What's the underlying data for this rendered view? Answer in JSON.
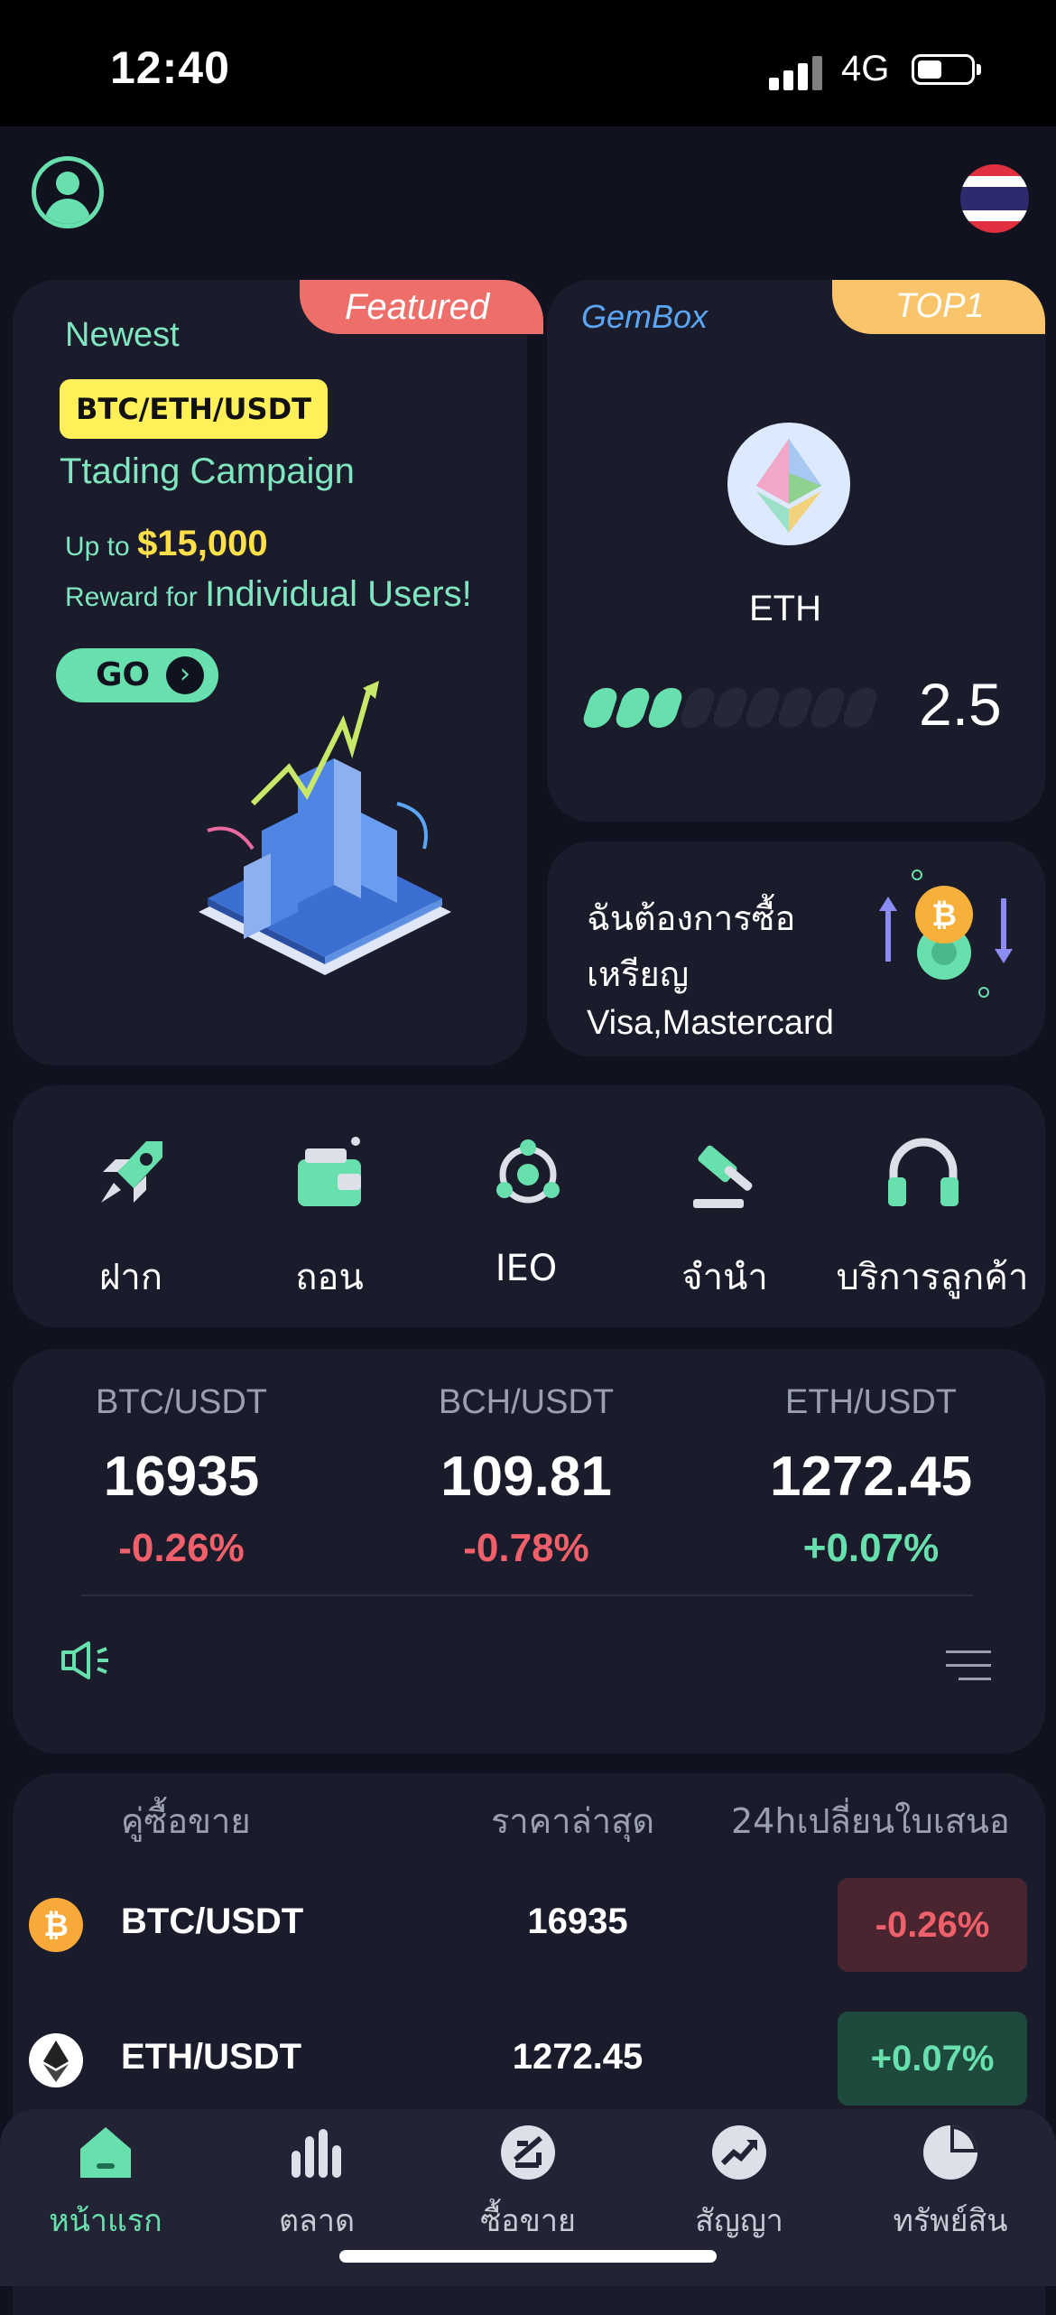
{
  "status_bar": {
    "time": "12:40",
    "network": "4G"
  },
  "featured": {
    "tag": "Featured",
    "newest": "Newest",
    "pairs": "BTC/ETH/USDT",
    "campaign": "Ttading Campaign",
    "upto_prefix": "Up to",
    "upto_amount": "$15,000",
    "reward_prefix": "Reward for",
    "reward_target": "Individual Users!",
    "go": "GO",
    "go_arrow": "›"
  },
  "gembox": {
    "title": "GemBox",
    "tag": "TOP1",
    "coin": "ETH",
    "score": "2.5",
    "progress_fraction": 0.3
  },
  "buy_coin": {
    "line1": "ฉันต้องการซื้อ",
    "line2": "เหรียญ",
    "line3": "Visa,Mastercard"
  },
  "quick_actions": [
    {
      "label": "ฝาก",
      "icon": "rocket-icon"
    },
    {
      "label": "ถอน",
      "icon": "wallet-icon"
    },
    {
      "label": "IEO",
      "icon": "ieo-orbit-icon"
    },
    {
      "label": "จำนำ",
      "icon": "gavel-icon"
    },
    {
      "label": "บริการลูกค้า",
      "icon": "headset-icon"
    }
  ],
  "tickers": [
    {
      "pair": "BTC/USDT",
      "price": "16935",
      "change": "-0.26%"
    },
    {
      "pair": "BCH/USDT",
      "price": "109.81",
      "change": "-0.78%"
    },
    {
      "pair": "ETH/USDT",
      "price": "1272.45",
      "change": "+0.07%"
    }
  ],
  "market": {
    "headers": [
      "คู่ซื้อขาย",
      "ราคาล่าสุด",
      "24hเปลี่ยนใบเสนอ"
    ],
    "rows": [
      {
        "pair": "BTC/USDT",
        "price": "16935",
        "change": "-0.26%",
        "icon": "btc-icon"
      },
      {
        "pair": "ETH/USDT",
        "price": "1272.45",
        "change": "+0.07%",
        "icon": "eth-icon"
      }
    ]
  },
  "nav": [
    {
      "label": "หน้าแรก",
      "icon": "home-icon",
      "active": true
    },
    {
      "label": "ตลาด",
      "icon": "bar-chart-icon"
    },
    {
      "label": "ซื้อขาย",
      "icon": "trade-icon"
    },
    {
      "label": "สัญญา",
      "icon": "contract-trend-icon"
    },
    {
      "label": "ทรัพย์สิน",
      "icon": "pie-chart-icon"
    }
  ],
  "colors": {
    "accent": "#68e0ad",
    "negative": "#f0606a",
    "positive": "#68e0ad",
    "background": "#11121f",
    "card": "#1b1c2b"
  }
}
